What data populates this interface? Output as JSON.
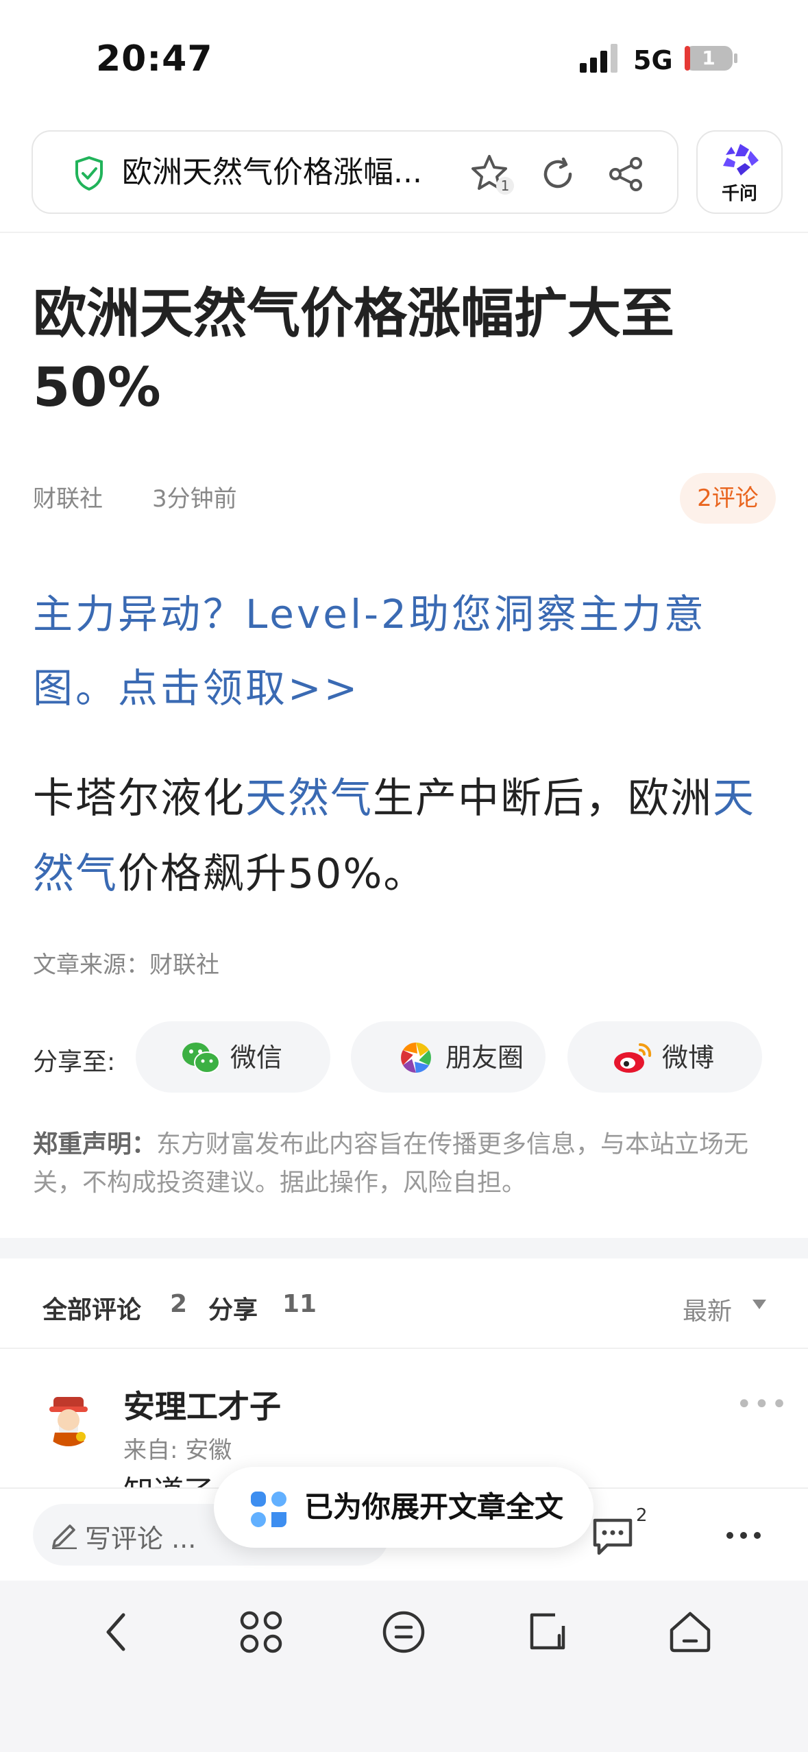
{
  "status_bar": {
    "time": "20:47",
    "network": "5G",
    "battery": "1"
  },
  "address_bar": {
    "title": "欧洲天然气价格涨幅...",
    "star_count": "1"
  },
  "ai_button": {
    "label": "千问"
  },
  "article": {
    "title": "欧洲天然气价格涨幅扩大至50%",
    "source": "财联社",
    "time_ago": "3分钟前",
    "comments_pill": "2评论",
    "promo": "主力异动？Level-2助您洞察主力意图。点击领取>>",
    "body": {
      "part1": "卡塔尔液化",
      "kw1": "天然气",
      "part2": "生产中断后，欧洲",
      "kw2": "天然气",
      "part3": "价格飙升50%。"
    },
    "source_line": "文章来源：财联社"
  },
  "share": {
    "label": "分享至:",
    "wechat": "微信",
    "moments": "朋友圈",
    "weibo": "微博"
  },
  "disclaimer": {
    "heading": "郑重声明：",
    "text": "东方财富发布此内容旨在传播更多信息，与本站立场无关，不构成投资建议。据此操作，风险自担。"
  },
  "comments": {
    "all_label": "全部评论",
    "all_count": "2",
    "share_label": "分享",
    "share_count": "11",
    "sort": "最新",
    "items": [
      {
        "user": "安理工才子",
        "location": "来自: 安徽",
        "text": "知道了"
      }
    ]
  },
  "toast": {
    "text": "已为你展开文章全文"
  },
  "action_bar": {
    "write_placeholder": "写评论 ...",
    "comment_count": "2"
  },
  "colors": {
    "link": "#3a6ab3",
    "accent_orange": "#e9651f",
    "toast_icon": "#3d8ef0"
  }
}
